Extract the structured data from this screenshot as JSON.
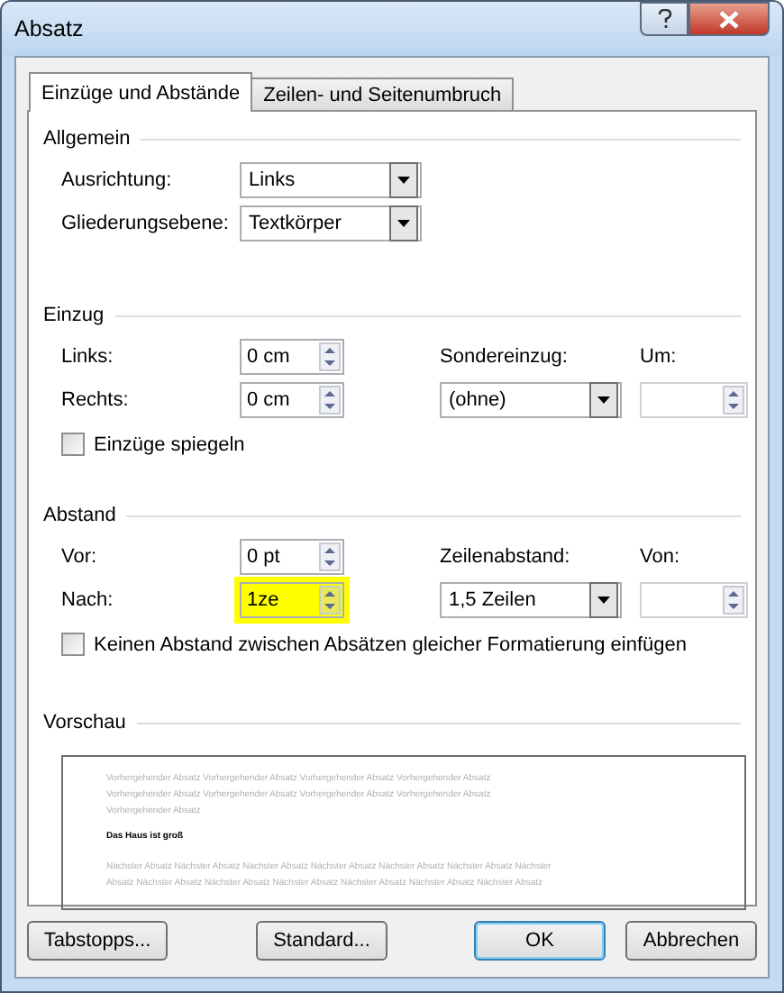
{
  "window": {
    "title": "Absatz"
  },
  "tabs": [
    {
      "label": "Einzüge und Abstände",
      "selected": true
    },
    {
      "label": "Zeilen- und Seitenumbruch",
      "selected": false
    }
  ],
  "general": {
    "heading": "Allgemein",
    "fields": [
      {
        "label": "Ausrichtung:",
        "value": "Links"
      },
      {
        "label": "Gliederungsebene:",
        "value": "Textkörper"
      }
    ]
  },
  "indent": {
    "heading": "Einzug",
    "left": {
      "label": "Links:",
      "value": "0 cm",
      "highlighted": false
    },
    "right": {
      "label": "Rechts:",
      "value": "0 cm",
      "highlighted": false
    },
    "special": {
      "label": "Sondereinzug:",
      "value": "(ohne)"
    },
    "by": {
      "label": "Um:",
      "disabled": true
    },
    "mirror": {
      "label": "Einzüge spiegeln",
      "checked": false
    }
  },
  "spacing": {
    "heading": "Abstand",
    "before": {
      "label": "Vor:",
      "value": "0 pt",
      "highlighted": false
    },
    "after": {
      "label": "Nach:",
      "value": "1ze",
      "highlighted": true
    },
    "line_spacing": {
      "label": "Zeilenabstand:",
      "value": "1,5 Zeilen"
    },
    "at": {
      "label": "Von:",
      "disabled": true
    },
    "no_space": {
      "label": "Keinen Abstand zwischen Absätzen gleicher Formatierung einfügen",
      "checked": false
    }
  },
  "preview": {
    "heading": "Vorschau",
    "previous_lines": [
      "Vorhergehender Absatz Vorhergehender Absatz Vorhergehender Absatz Vorhergehender Absatz",
      "Vorhergehender Absatz Vorhergehender Absatz Vorhergehender Absatz Vorhergehender Absatz",
      "Vorhergehender Absatz"
    ],
    "current": "Das Haus ist groß",
    "next_lines": [
      "Nächster Absatz Nächster Absatz Nächster Absatz Nächster Absatz Nächster Absatz Nächster Absatz Nächster",
      "Absatz Nächster Absatz Nächster Absatz Nächster Absatz Nächster Absatz Nächster Absatz Nächster Absatz"
    ]
  },
  "buttons": [
    {
      "label": "Tabstopps...",
      "default": false
    },
    {
      "label": "Standard...",
      "default": false
    },
    {
      "label": "OK",
      "default": true
    },
    {
      "label": "Abbrechen",
      "default": false
    }
  ]
}
